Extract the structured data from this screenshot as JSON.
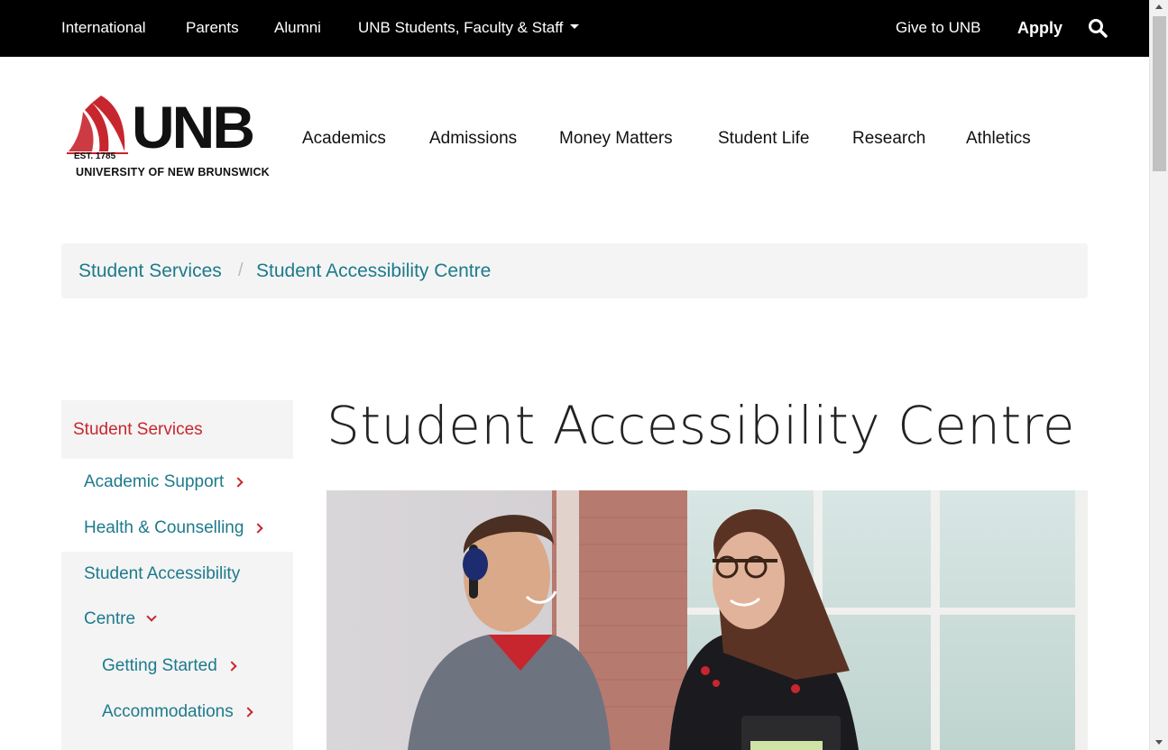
{
  "topbar": {
    "links": [
      "International",
      "Parents",
      "Alumni",
      "UNB Students, Faculty & Staff"
    ],
    "give": "Give to UNB",
    "apply": "Apply",
    "search_icon": "search-icon"
  },
  "logo": {
    "wordmark": "UNB",
    "est": "EST. 1785",
    "name": "UNIVERSITY OF NEW BRUNSWICK"
  },
  "mainnav": [
    "Academics",
    "Admissions",
    "Money Matters",
    "Student Life",
    "Research",
    "Athletics"
  ],
  "breadcrumb": {
    "items": [
      "Student Services",
      "Student Accessibility Centre"
    ],
    "separator": "/"
  },
  "sidebar": {
    "heading": "Student Services",
    "items": [
      {
        "label": "Academic Support"
      },
      {
        "label": "Health & Counselling"
      },
      {
        "label_line1": "Student Accessibility",
        "label_line2": "Centre"
      },
      {
        "label": "Getting Started"
      },
      {
        "label": "Accommodations"
      }
    ]
  },
  "main": {
    "title": "Student Accessibility Centre"
  },
  "colors": {
    "topbar_bg": "#000000",
    "link_teal": "#1d7a8c",
    "accent_red": "#c8262e",
    "panel_gray": "#f4f4f4"
  }
}
